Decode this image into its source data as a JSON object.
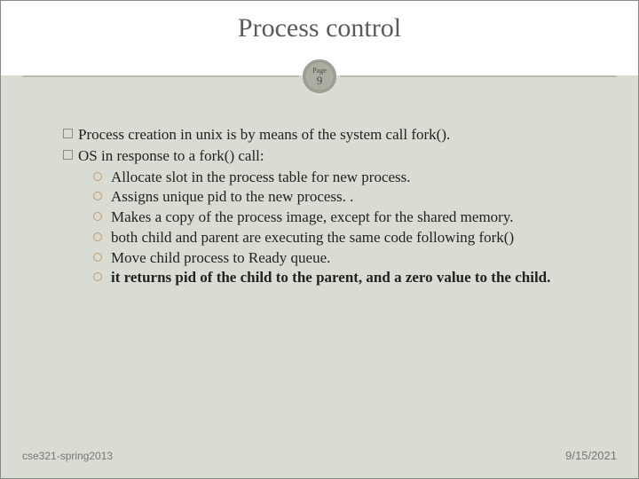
{
  "title": "Process control",
  "badge": {
    "label": "Page",
    "num": "9"
  },
  "bullets": [
    "Process creation in unix is by means of the system call fork().",
    "OS in response to a fork() call:"
  ],
  "subbullets": [
    "Allocate slot in the process table for new process.",
    "Assigns unique pid to the new process. .",
    "Makes a copy of the process image, except for the shared memory.",
    "both child and parent are executing the same code following fork()",
    "Move child process to Ready queue.",
    "it returns pid of the child to the parent, and a zero value to the child."
  ],
  "footer": {
    "left": "cse321-spring2013",
    "right": "9/15/2021"
  }
}
